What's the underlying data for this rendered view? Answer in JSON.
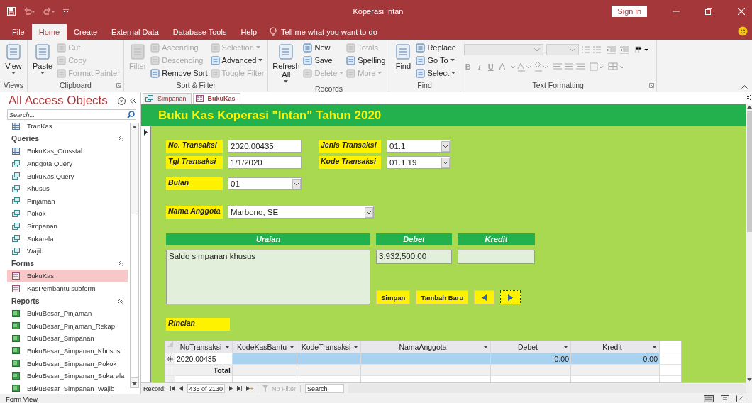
{
  "window": {
    "title": "Koperasi Intan",
    "sign_in": "Sign in"
  },
  "menu_tabs": [
    {
      "label": "File",
      "selected": false
    },
    {
      "label": "Home",
      "selected": true
    },
    {
      "label": "Create",
      "selected": false
    },
    {
      "label": "External Data",
      "selected": false
    },
    {
      "label": "Database Tools",
      "selected": false
    },
    {
      "label": "Help",
      "selected": false
    }
  ],
  "tell_me": "Tell me what you want to do",
  "ribbon": {
    "groups": [
      {
        "label": "Views",
        "kind": "commands",
        "launcher": false,
        "columns": [
          [
            {
              "label": "View",
              "kind": "large",
              "disabled": false,
              "dropdown": true
            }
          ]
        ]
      },
      {
        "label": "Clipboard",
        "kind": "commands",
        "launcher": true,
        "columns": [
          [
            {
              "label": "Paste",
              "kind": "large",
              "disabled": false,
              "dropdown": true
            }
          ],
          [
            {
              "label": "Cut",
              "kind": "small",
              "disabled": true,
              "dropdown": false
            },
            {
              "label": "Copy",
              "kind": "small",
              "disabled": true,
              "dropdown": false
            },
            {
              "label": "Format Painter",
              "kind": "small",
              "disabled": true,
              "dropdown": false
            }
          ]
        ]
      },
      {
        "label": "Sort & Filter",
        "kind": "commands",
        "launcher": false,
        "columns": [
          [
            {
              "label": "Filter",
              "kind": "large",
              "disabled": true,
              "dropdown": false
            }
          ],
          [
            {
              "label": "Ascending",
              "kind": "small",
              "disabled": true,
              "dropdown": false
            },
            {
              "label": "Descending",
              "kind": "small",
              "disabled": true,
              "dropdown": false
            },
            {
              "label": "Remove Sort",
              "kind": "small",
              "disabled": false,
              "dropdown": false
            }
          ],
          [
            {
              "label": "Selection",
              "kind": "small",
              "disabled": true,
              "dropdown": true
            },
            {
              "label": "Advanced",
              "kind": "small",
              "disabled": false,
              "dropdown": true
            },
            {
              "label": "Toggle Filter",
              "kind": "small",
              "disabled": true,
              "dropdown": false
            }
          ]
        ]
      },
      {
        "label": "Records",
        "kind": "commands",
        "launcher": false,
        "columns": [
          [
            {
              "label": "Refresh All",
              "kind": "large",
              "disabled": false,
              "dropdown": true
            }
          ],
          [
            {
              "label": "New",
              "kind": "small",
              "disabled": false,
              "dropdown": false
            },
            {
              "label": "Save",
              "kind": "small",
              "disabled": false,
              "dropdown": false
            },
            {
              "label": "Delete",
              "kind": "small",
              "disabled": true,
              "dropdown": true
            }
          ],
          [
            {
              "label": "Totals",
              "kind": "small",
              "disabled": true,
              "dropdown": false
            },
            {
              "label": "Spelling",
              "kind": "small",
              "disabled": false,
              "dropdown": false
            },
            {
              "label": "More",
              "kind": "small",
              "disabled": true,
              "dropdown": true
            }
          ]
        ]
      },
      {
        "label": "Find",
        "kind": "commands",
        "launcher": false,
        "columns": [
          [
            {
              "label": "Find",
              "kind": "large",
              "disabled": false,
              "dropdown": false
            }
          ],
          [
            {
              "label": "Replace",
              "kind": "small",
              "disabled": false,
              "dropdown": false
            },
            {
              "label": "Go To",
              "kind": "small",
              "disabled": false,
              "dropdown": true
            },
            {
              "label": "Select",
              "kind": "small",
              "disabled": false,
              "dropdown": true
            }
          ]
        ]
      },
      {
        "label": "Text Formatting",
        "kind": "formatting",
        "launcher": true,
        "buttons": [
          "B",
          "I",
          "U",
          "A"
        ]
      }
    ]
  },
  "navigation": {
    "title": "All Access Objects",
    "search": {
      "placeholder": "Search..."
    },
    "groups": [
      {
        "items": [
          {
            "label": "TranKas",
            "kind": "table",
            "selected": false
          }
        ]
      },
      {
        "title": "Queries",
        "items": [
          {
            "label": "BukuKas_Crosstab",
            "kind": "crosstab",
            "selected": false
          },
          {
            "label": "Anggota Query",
            "kind": "query",
            "selected": false
          },
          {
            "label": "BukuKas Query",
            "kind": "query",
            "selected": false
          },
          {
            "label": "Khusus",
            "kind": "query",
            "selected": false
          },
          {
            "label": "Pinjaman",
            "kind": "query",
            "selected": false
          },
          {
            "label": "Pokok",
            "kind": "query",
            "selected": false
          },
          {
            "label": "Simpanan",
            "kind": "query",
            "selected": false
          },
          {
            "label": "Sukarela",
            "kind": "query",
            "selected": false
          },
          {
            "label": "Wajib",
            "kind": "query",
            "selected": false
          }
        ]
      },
      {
        "title": "Forms",
        "items": [
          {
            "label": "BukuKas",
            "kind": "form",
            "selected": true
          },
          {
            "label": "KasPembantu subform",
            "kind": "form",
            "selected": false
          }
        ]
      },
      {
        "title": "Reports",
        "items": [
          {
            "label": "BukuBesar_Pinjaman",
            "kind": "report",
            "selected": false
          },
          {
            "label": "BukuBesar_Pinjaman_Rekap",
            "kind": "report",
            "selected": false
          },
          {
            "label": "BukuBesar_Simpanan",
            "kind": "report",
            "selected": false
          },
          {
            "label": "BukuBesar_Simpanan_Khusus",
            "kind": "report",
            "selected": false
          },
          {
            "label": "BukuBesar_Simpanan_Pokok",
            "kind": "report",
            "selected": false
          },
          {
            "label": "BukuBesar_Simpanan_Sukarela",
            "kind": "report",
            "selected": false
          },
          {
            "label": "BukuBesar_Simpanan_Wajib",
            "kind": "report",
            "selected": false
          }
        ]
      }
    ]
  },
  "document_tabs": [
    {
      "label": "Simpanan",
      "kind": "query",
      "selected": false
    },
    {
      "label": "BukuKas",
      "kind": "form",
      "selected": true
    }
  ],
  "form": {
    "title": "Buku Kas Koperasi \"Intan\" Tahun 2020",
    "field_rows": [
      [
        {
          "label": "No. Transaksi",
          "value": "2020.00435",
          "kind": "text"
        },
        {
          "label": "Jenis Transaksi",
          "value": "01.1",
          "kind": "combo"
        }
      ],
      [
        {
          "label": "Tgl Transaksi",
          "value": "1/1/2020",
          "kind": "text"
        },
        {
          "label": "Kode Transaksi",
          "value": "01.1.19",
          "kind": "combo"
        }
      ],
      [
        {
          "label": "Bulan",
          "value": "01",
          "kind": "combo"
        }
      ],
      [
        {
          "label": "Nama Anggota",
          "value": "Marbono, SE",
          "kind": "combo"
        }
      ]
    ],
    "entry": {
      "headers": [
        "Uraian",
        "Debet",
        "Kredit"
      ],
      "uraian": "Saldo simpanan khusus",
      "debet": "3,932,500.00"
    },
    "buttons": [
      {
        "kind": "text",
        "label": "Simpan",
        "focused": false
      },
      {
        "kind": "text",
        "label": "Tambah Baru",
        "focused": false
      },
      {
        "kind": "previous",
        "focused": false
      },
      {
        "kind": "next",
        "focused": true
      }
    ],
    "rincian": "Rincian",
    "datasheet": {
      "columns": [
        "NoTransaksi",
        "KodeKasBantu",
        "KodeTransaksi",
        "NamaAnggota",
        "Debet",
        "Kredit"
      ],
      "rows": [
        {
          "kind": "new",
          "cells": [
            "2020.00435",
            null,
            null,
            null,
            "0.00",
            "0.00"
          ]
        },
        {
          "kind": "total",
          "cells": [
            "Total",
            null,
            null,
            null,
            null,
            null
          ]
        }
      ]
    },
    "record_nav": {
      "label": "Record:",
      "position": "435 of 2130",
      "filter": "No Filter",
      "filter_disabled": true,
      "search_placeholder": "Search"
    }
  },
  "status_bar": {
    "text": "Form View"
  }
}
